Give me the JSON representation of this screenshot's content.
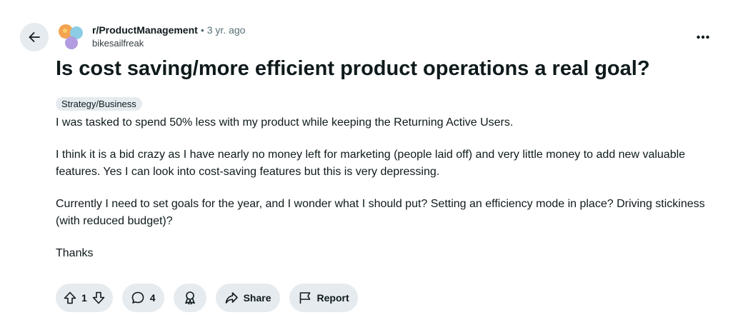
{
  "post": {
    "subreddit": "r/ProductManagement",
    "separator": "•",
    "timestamp": "3 yr. ago",
    "author": "bikesailfreak",
    "title": "Is cost saving/more efficient product operations a real goal?",
    "flair": "Strategy/Business",
    "paragraphs": [
      "I was tasked to spend 50% less with my product while keeping the Returning Active Users.",
      "I think it is a bid crazy as I have nearly no money left for marketing (people laid off) and very little money to add new valuable features. Yes I can look into cost-saving features but this is very depressing.",
      "Currently I need to set goals for the year, and I wonder what I should put? Setting an efficiency mode in place? Driving stickiness (with reduced budget)?",
      "Thanks"
    ]
  },
  "actions": {
    "vote_count": "1",
    "comment_count": "4",
    "share_label": "Share",
    "report_label": "Report"
  },
  "icons": {
    "back": "arrow-left-icon",
    "more": "more-horizontal-icon",
    "upvote": "arrow-up-icon",
    "downvote": "arrow-down-icon",
    "comment": "comment-bubble-icon",
    "award": "award-icon",
    "share": "share-arrow-icon",
    "report": "flag-icon"
  },
  "colors": {
    "pill_bg": "#e5ebee",
    "text_primary": "#0f1a1c",
    "text_secondary": "#576f76"
  }
}
